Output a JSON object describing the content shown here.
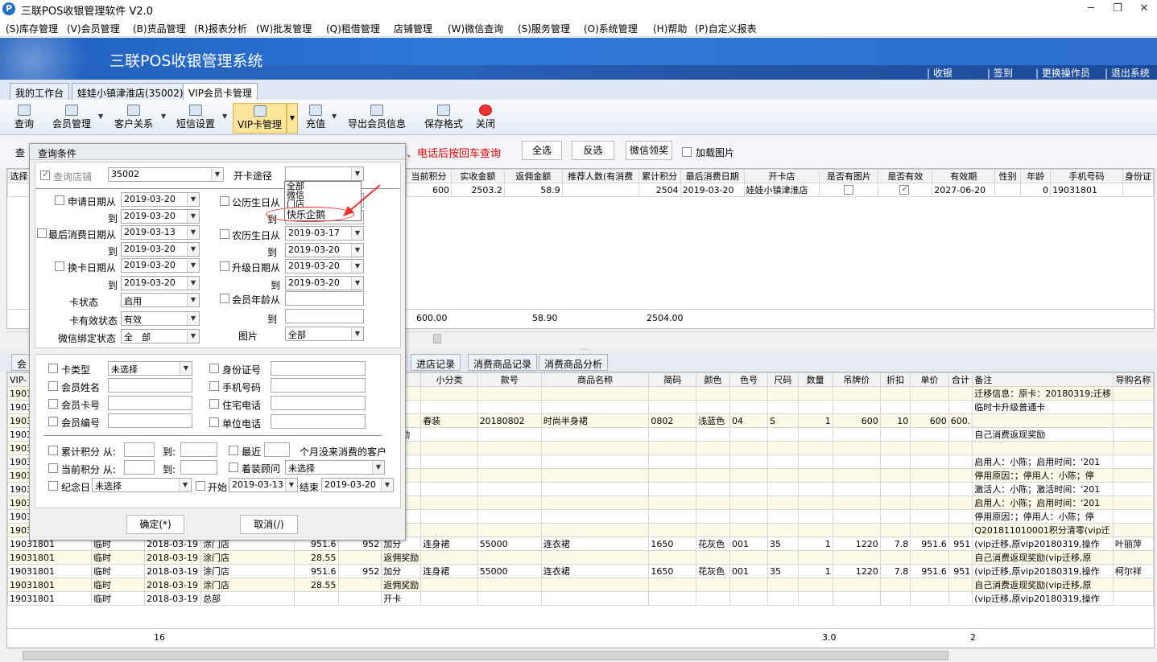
{
  "app": {
    "icon": "P",
    "title": "三联POS收银管理软件 V2.0",
    "win_min": "─",
    "win_max": "❐",
    "win_close": "✕"
  },
  "menu": [
    "(S)库存管理",
    "(V)会员管理",
    "(B)货品管理",
    "(R)报表分析",
    "(W)批发管理",
    "(Q)租借管理",
    "店铺管理",
    "(W)微信查询",
    "(S)服务管理",
    "(O)系统管理",
    "(H)帮助",
    "(P)自定义报表"
  ],
  "banner": {
    "title": "三联POS收银管理系统",
    "links": [
      "收银",
      "签到",
      "更换操作员",
      "退出系统"
    ]
  },
  "tabs": [
    "我的工作台",
    "娃娃小镇津淮店(35002)",
    "VIP会员卡管理"
  ],
  "toolbar": [
    "查询",
    "会员管理",
    "客户关系",
    "短信设置",
    "VIP卡管理",
    "充值",
    "导出会员信息",
    "保存格式",
    "关闭"
  ],
  "filter": {
    "left_label": "查",
    "hint": "、电话后按回车查询",
    "select_all": "全选",
    "invert": "反选",
    "wechat": "微信领奖",
    "load_img": "加载图片"
  },
  "top_grid": {
    "left_header": "选择",
    "headers": [
      "当前积分",
      "实收金额",
      "返佣金额",
      "推荐人数(有消费",
      "累计积分",
      "最后消费日期",
      "开卡店",
      "是否有图片",
      "是否有效",
      "有效期",
      "性别",
      "年龄",
      "手机号码",
      "身份证"
    ],
    "row": [
      "600",
      "2503.2",
      "58.9",
      "",
      "2504",
      "2019-03-20",
      "娃娃小镇津淮店",
      "",
      "",
      "2027-06-20",
      "",
      "0",
      "19031801",
      ""
    ],
    "totals": [
      "600.00",
      "58.90",
      "2504.00"
    ]
  },
  "dialog": {
    "title": "查询条件",
    "store_label": "查询店铺",
    "store_value": "35002",
    "channel_label": "开卡途径",
    "channel_options": [
      "全部",
      "微信",
      "门店",
      "快乐企鹅"
    ],
    "apply_from": "申请日期从",
    "apply_from_v": "2019-03-20",
    "apply_to_v": "2019-03-20",
    "birth_label": "公历生日从",
    "to": "到",
    "lastbuy_label": "最后消费日期从",
    "lastbuy_from_v": "2019-03-13",
    "lastbuy_to_v": "2019-03-20",
    "lunar_label": "农历生日从",
    "lunar_from_v": "2019-03-17",
    "lunar_to_v": "2019-03-20",
    "change_label": "换卡日期从",
    "change_from_v": "2019-03-20",
    "change_to_v": "2019-03-20",
    "upgrade_label": "升级日期从",
    "upgrade_from_v": "2019-03-20",
    "upgrade_to_v": "2019-03-20",
    "card_status_label": "卡状态",
    "card_status_v": "启用",
    "age_label": "会员年龄从",
    "valid_label": "卡有效状态",
    "valid_v": "有效",
    "wechat_label": "微信绑定状态",
    "wechat_v": "全　部",
    "pic_label": "图片",
    "pic_v": "全部",
    "card_type_label": "卡类型",
    "card_type_v": "未选择",
    "idcard_label": "身份证号",
    "name_label": "会员姓名",
    "mobile_label": "手机号码",
    "cardno_label": "会员卡号",
    "home_label": "住宅电话",
    "memno_label": "会员编号",
    "work_label": "单位电话",
    "sum_points_label": "累计积分 从:",
    "recent_label": "最近",
    "months_label": "个月没来消费的客户",
    "cur_points_label": "当前积分 从:",
    "advisor_label": "着装顾问",
    "advisor_v": "未选择",
    "to_colon": "到:",
    "memorial_label": "纪念日",
    "memorial_v": "未选择",
    "start_label": "开始",
    "start_v": "2019-03-13",
    "end_label": "结束",
    "end_v": "2019-03-20",
    "ok": "确定(*)",
    "cancel": "取消(/)"
  },
  "bottom_tabs": [
    "会",
    "进店记录",
    "消费商品记录",
    "消费商品分析"
  ],
  "bottom_grid": {
    "left_header": "VIP-",
    "headers": [
      "型",
      "小分类",
      "款号",
      "商品名称",
      "简码",
      "颜色",
      "色号",
      "尺码",
      "数量",
      "吊牌价",
      "折扣",
      "单价",
      "合计",
      "备注",
      "导购名称"
    ],
    "rows": [
      {
        "c": [
          "19031",
          "",
          "",
          "",
          "",
          "",
          "",
          "",
          "",
          "",
          "",
          "",
          "",
          "",
          "",
          "",
          "",
          "",
          ""
        ],
        "t": "",
        "n": "迁移信息：原卡：20180319;迁移",
        "g": ""
      },
      {
        "c": [
          "19031"
        ],
        "t": "级",
        "n": "临时卡升级普通卡",
        "g": ""
      },
      {
        "c": [
          "19031"
        ],
        "t": "分",
        "sub": "春装",
        "code": "20180802",
        "name": "时尚半身裙",
        "sc": "0802",
        "color": "浅蓝色",
        "cn": "04",
        "size": "S",
        "qty": "1",
        "tag": "600",
        "disc": "10",
        "price": "600",
        "sum": "600.",
        "n": "",
        "g": ""
      },
      {
        "c": [
          "19031"
        ],
        "t": "用奖励",
        "n": "自己消费返现奖励",
        "g": ""
      },
      {
        "c": [
          "19031"
        ],
        "t": "卡",
        "n": "",
        "g": ""
      },
      {
        "c": [
          "19031"
        ],
        "t": "用",
        "n": "启用人：小陈；启用时间：'201",
        "g": ""
      },
      {
        "c": [
          "19031"
        ],
        "t": "用",
        "n": "停用原因：；停用人：小陈；停",
        "g": ""
      },
      {
        "c": [
          "19031"
        ],
        "t": "活",
        "n": "激活人：小陈；激活时间：'201",
        "g": ""
      },
      {
        "c": [
          "19031"
        ],
        "t": "用",
        "n": "启用人：小陈；启用时间：'201",
        "g": ""
      },
      {
        "c": [
          "19031"
        ],
        "t": "用",
        "n": "停用原因：；停用人：小陈；停",
        "g": ""
      },
      {
        "c": [
          "19031"
        ],
        "t": "分",
        "n": "Q201811010001积分清零(vip迁",
        "g": ""
      }
    ],
    "full_rows": [
      [
        "19031801",
        "临时",
        "2018-03-19",
        "涂门店",
        "951.6",
        "952",
        "加分",
        "连身裙",
        "55000",
        "连衣裙",
        "1650",
        "花灰色",
        "001",
        "35",
        "1",
        "1220",
        "7.8",
        "951.6",
        "951",
        "(vip迁移,原vip20180319,操作",
        "叶丽萍"
      ],
      [
        "19031801",
        "临时",
        "2018-03-19",
        "涂门店",
        "28.55",
        "",
        "返佣奖励",
        "",
        "",
        "",
        "",
        "",
        "",
        "",
        "",
        "",
        "",
        "",
        "",
        "自己消费返现奖励(vip迁移,原",
        ""
      ],
      [
        "19031801",
        "临时",
        "2018-03-19",
        "涂门店",
        "951.6",
        "952",
        "加分",
        "连身裙",
        "55000",
        "连衣裙",
        "1650",
        "花灰色",
        "001",
        "35",
        "1",
        "1220",
        "7.8",
        "951.6",
        "951",
        "(vip迁移,原vip20180319,操作",
        "柯尔祥"
      ],
      [
        "19031801",
        "临时",
        "2018-03-19",
        "涂门店",
        "28.55",
        "",
        "返佣奖励",
        "",
        "",
        "",
        "",
        "",
        "",
        "",
        "",
        "",
        "",
        "",
        "",
        "自己消费返现奖励(vip迁移,原",
        ""
      ],
      [
        "19031801",
        "临时",
        "2018-03-19",
        "总部",
        "",
        "",
        "开卡",
        "",
        "",
        "",
        "",
        "",
        "",
        "",
        "",
        "",
        "",
        "",
        "",
        "(vip迁移,原vip20180319,操作",
        ""
      ]
    ],
    "totals": {
      "count": "16",
      "qty": "3.0",
      "sum": "2"
    }
  }
}
